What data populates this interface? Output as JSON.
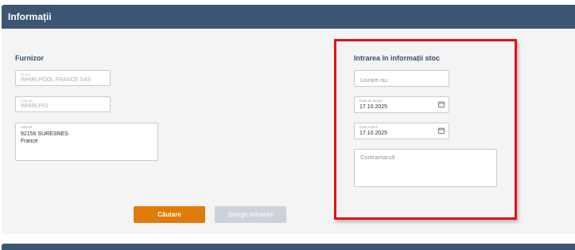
{
  "header": {
    "title": "Informații"
  },
  "supplier": {
    "title": "Furnizor",
    "name_label": "Nume",
    "name_value": "WHIRLPOOL FRANCE SAS",
    "code_label": "Cod ofe",
    "code_value": "WHIRLP01",
    "address_label": "Adresa",
    "address_line1": "92156 SURESNES",
    "address_line2": "France"
  },
  "stock_entry": {
    "title": "Intrarea în informații stoc",
    "delivery_placeholder": "Livrare nu.",
    "delivery_date_label": "Data de livrare",
    "delivery_date_value": "17.10.2025",
    "order_date_label": "Data ordinii",
    "order_date_value": "17.10.2025",
    "countermark_placeholder": "Contramarcă"
  },
  "actions": {
    "search_label": "Căutare",
    "delete_label": "Șterge intrarea"
  },
  "colors": {
    "header_bg": "#3c5573",
    "primary_button": "#e07a09",
    "disabled_button": "#ccd2d9",
    "highlight_border": "#e21313"
  }
}
